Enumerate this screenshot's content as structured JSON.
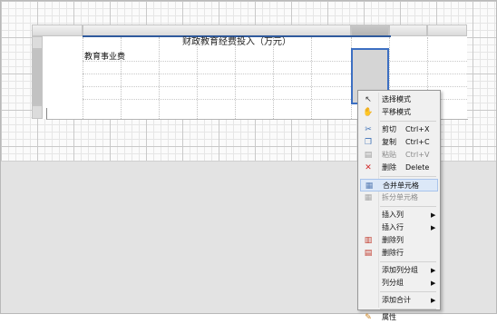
{
  "report": {
    "title": "财政教育经费投入（万元）",
    "row_label": "教育事业费"
  },
  "context_menu": {
    "groups": [
      [
        {
          "label": "选择模式",
          "icon": "cursor-arrow-icon"
        },
        {
          "label": "平移模式",
          "icon": "hand-pan-icon"
        }
      ],
      [
        {
          "label": "剪切",
          "shortcut": "Ctrl+X",
          "icon": "scissors-icon"
        },
        {
          "label": "复制",
          "shortcut": "Ctrl+C",
          "icon": "copy-icon"
        },
        {
          "label": "粘贴",
          "shortcut": "Ctrl+V",
          "icon": "paste-icon",
          "disabled": true
        },
        {
          "label": "删除",
          "shortcut": "Delete",
          "icon": "delete-x-icon"
        }
      ],
      [
        {
          "label": "合并单元格",
          "icon": "merge-cells-icon",
          "highlighted": true
        },
        {
          "label": "拆分单元格",
          "icon": "split-cells-icon",
          "disabled": true
        }
      ],
      [
        {
          "label": "插入列",
          "submenu": true
        },
        {
          "label": "插入行",
          "submenu": true
        },
        {
          "label": "删除列",
          "icon": "delete-column-icon"
        },
        {
          "label": "删除行",
          "icon": "delete-row-icon"
        }
      ],
      [
        {
          "label": "添加列分组",
          "submenu": true
        },
        {
          "label": "列分组",
          "submenu": true
        }
      ],
      [
        {
          "label": "添加合计",
          "submenu": true
        }
      ],
      [
        {
          "label": "属性",
          "icon": "properties-icon"
        }
      ]
    ]
  }
}
